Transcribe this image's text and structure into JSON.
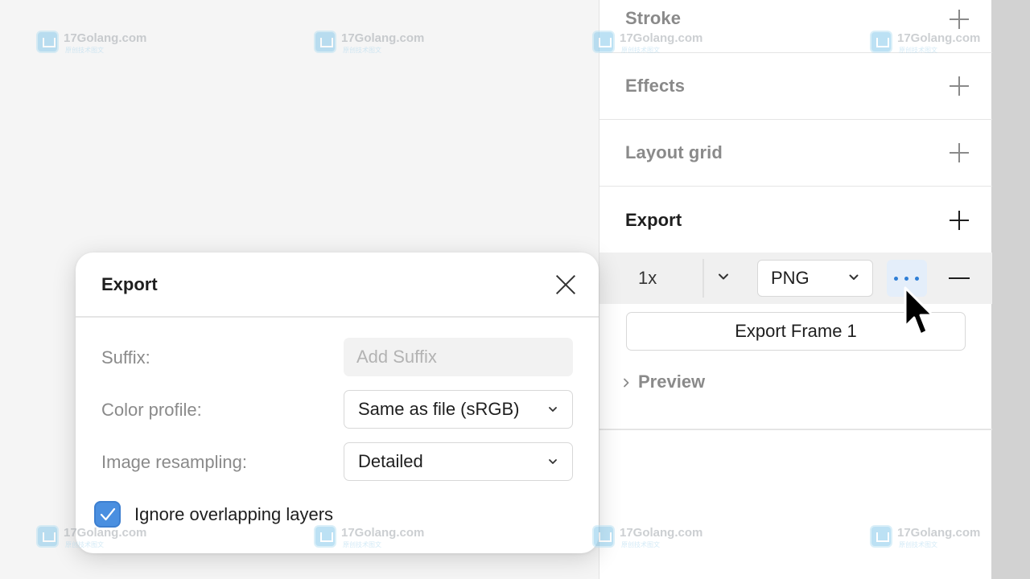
{
  "panel": {
    "sections": [
      {
        "title": "Stroke"
      },
      {
        "title": "Effects"
      },
      {
        "title": "Layout grid"
      },
      {
        "title": "Export"
      }
    ],
    "export_row": {
      "scale": "1x",
      "format": "PNG"
    },
    "export_button_label": "Export Frame 1",
    "preview_label": "Preview"
  },
  "dialog": {
    "title": "Export",
    "suffix_label": "Suffix:",
    "suffix_placeholder": "Add Suffix",
    "color_profile_label": "Color profile:",
    "color_profile_value": "Same as file (sRGB)",
    "resampling_label": "Image resampling:",
    "resampling_value": "Detailed",
    "ignore_overlapping_label": "Ignore overlapping layers",
    "ignore_overlapping_checked": true
  },
  "watermark": {
    "text": "17Golang.com",
    "subtext": "原创技术图文"
  },
  "colors": {
    "accent": "#4a8fe0",
    "more_button_bg": "#e4eefa",
    "panel_bg": "#ffffff",
    "canvas_bg": "#f5f5f5",
    "muted_text": "#8a8a8a"
  },
  "icons": [
    "plus-icon",
    "chevron-down-icon",
    "more-horizontal-icon",
    "minus-icon",
    "chevron-right-icon",
    "close-icon",
    "checkmark-icon",
    "cursor-icon",
    "watermark-logo-icon"
  ]
}
